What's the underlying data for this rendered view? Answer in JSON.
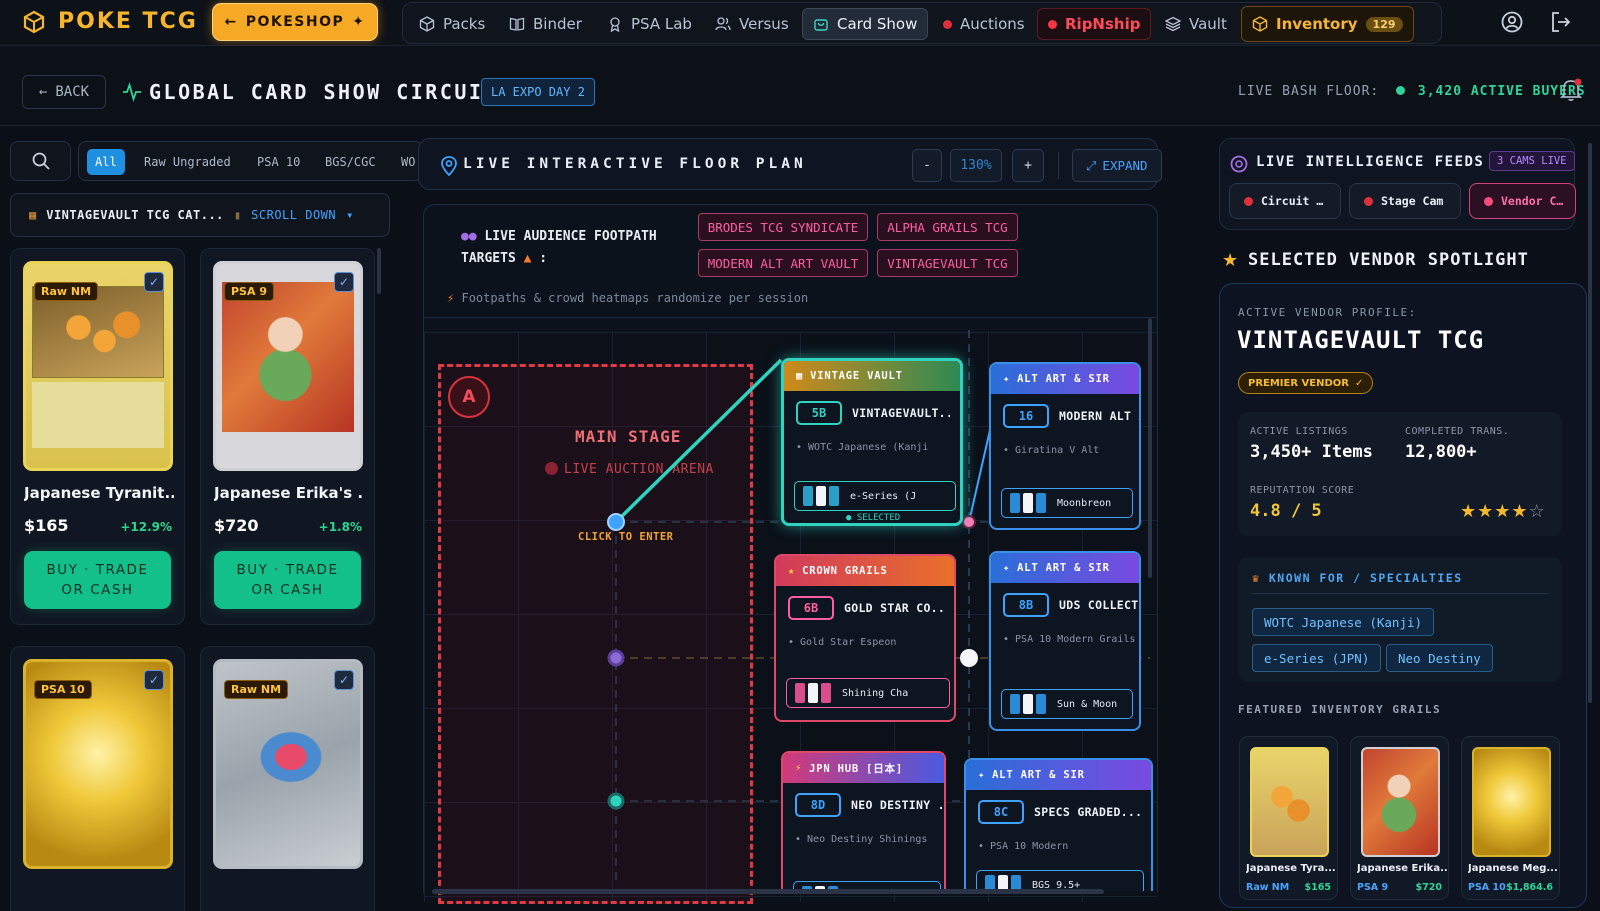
{
  "brand": {
    "name": "POKE TCG",
    "shop_label": "POKESHOP"
  },
  "nav": {
    "items": [
      {
        "label": "Packs",
        "icon": "box-icon"
      },
      {
        "label": "Binder",
        "icon": "book-icon"
      },
      {
        "label": "PSA Lab",
        "icon": "award-icon"
      },
      {
        "label": "Versus",
        "icon": "users-icon"
      },
      {
        "label": "Card Show",
        "icon": "bag-icon",
        "active": true
      },
      {
        "label": "Auctions",
        "icon": "dot-icon"
      },
      {
        "label": "RipNship",
        "icon": "dot-icon"
      },
      {
        "label": "Vault",
        "icon": "layers-icon"
      },
      {
        "label": "Inventory",
        "icon": "box-icon",
        "badge": "129"
      }
    ]
  },
  "subheader": {
    "back_label": "BACK",
    "title": "GLOBAL CARD SHOW CIRCUIT",
    "event_tag": "LA EXPO DAY 2",
    "live_label": "LIVE BASH FLOOR:",
    "buyers": "3,420 ACTIVE BUYERS"
  },
  "filters": {
    "chips": [
      "All",
      "Raw Ungraded",
      "PSA 10",
      "BGS/CGC",
      "WO"
    ],
    "active": "All"
  },
  "catalog": {
    "name": "VINTAGEVAULT TCG CAT...",
    "scroll_label": "SCROLL DOWN"
  },
  "cards": [
    {
      "title": "Japanese Tyranit...",
      "price": "$165",
      "change": "+12.9%",
      "condition": "Raw NM",
      "buy_label": "BUY · TRADE OR CASH"
    },
    {
      "title": "Japanese Erika's ...",
      "price": "$720",
      "change": "+1.8%",
      "condition": "PSA 9",
      "buy_label": "BUY · TRADE OR CASH"
    },
    {
      "condition": "PSA 10"
    },
    {
      "condition": "Raw NM"
    }
  ],
  "floorplan": {
    "title": "LIVE INTERACTIVE FLOOR PLAN",
    "zoom": "130%",
    "zoom_out": "-",
    "zoom_in": "+",
    "expand_label": "EXPAND",
    "targets_label_1": "LIVE AUDIENCE FOOTPATH",
    "targets_label_2": "TARGETS",
    "targets": [
      "BRODES TCG SYNDICATE",
      "ALPHA GRAILS TCG",
      "MODERN ALT ART VAULT",
      "VINTAGEVAULT TCG"
    ],
    "note": "Footpaths & crowd heatmaps randomize per session",
    "stage": {
      "marker": "A",
      "title": "MAIN STAGE",
      "subtitle": "LIVE AUCTION ARENA",
      "enter_label": "CLICK TO ENTER"
    },
    "booths": [
      {
        "header": "VINTAGE VAULT",
        "id": "5B",
        "name": "VINTAGEVAULT...",
        "note": "• WOTC Japanese (Kanji",
        "bar": "e-Series (J",
        "selected": "● SELECTED"
      },
      {
        "header": "ALT ART & SIR",
        "id": "16",
        "name": "MODERN ALT A...",
        "note": "• Giratina V Alt",
        "bar": "Moonbreon"
      },
      {
        "header": "CROWN GRAILS",
        "id": "6B",
        "name": "GOLD STAR CO...",
        "note": "• Gold Star Espeon",
        "bar": "Shining Cha"
      },
      {
        "header": "ALT ART & SIR",
        "id": "8B",
        "name": "UDS COLLECTI...",
        "note": "• PSA 10 Modern Grails",
        "bar": "Sun & Moon"
      },
      {
        "header": "JPN HUB [日本]",
        "id": "8D",
        "name": "NEO DESTINY ...",
        "note": "• Neo Destiny Shinings",
        "bar": ""
      },
      {
        "header": "ALT ART & SIR",
        "id": "8C",
        "name": "SPECS GRADED...",
        "note": "• PSA 10 Modern",
        "bar": "BGS 9.5+"
      }
    ]
  },
  "feeds": {
    "title": "LIVE INTELLIGENCE FEEDS",
    "badge": "3 CAMS LIVE",
    "tabs": [
      "Circuit …",
      "Stage Cam",
      "Vendor C…"
    ]
  },
  "spotlight": {
    "title": "SELECTED VENDOR SPOTLIGHT",
    "profile_label": "ACTIVE VENDOR PROFILE:",
    "vendor_name": "VINTAGEVAULT TCG",
    "premier_label": "PREMIER VENDOR",
    "stats": {
      "listings_label": "ACTIVE LISTINGS",
      "listings": "3,450+ Items",
      "trans_label": "COMPLETED TRANS.",
      "trans": "12,800+",
      "rep_label": "REPUTATION SCORE",
      "rep": "4.8 / 5",
      "stars": 4
    },
    "known_title": "KNOWN FOR / SPECIALTIES",
    "specialties": [
      "WOTC Japanese (Kanji)",
      "e-Series (JPN)",
      "Neo Destiny"
    ],
    "featured_title": "FEATURED INVENTORY GRAILS",
    "featured": [
      {
        "name": "Japanese Tyra...",
        "condition": "Raw NM",
        "price": "$165"
      },
      {
        "name": "Japanese Erika...",
        "condition": "PSA 9",
        "price": "$720"
      },
      {
        "name": "Japanese Meg...",
        "condition": "PSA 10",
        "price": "$1,864.6"
      }
    ]
  },
  "colors": {
    "accent": "#f6a925",
    "teal": "#2fd3c0",
    "pink": "#ff5e9f",
    "blue": "#3ea3ff",
    "green": "#13c08a"
  }
}
